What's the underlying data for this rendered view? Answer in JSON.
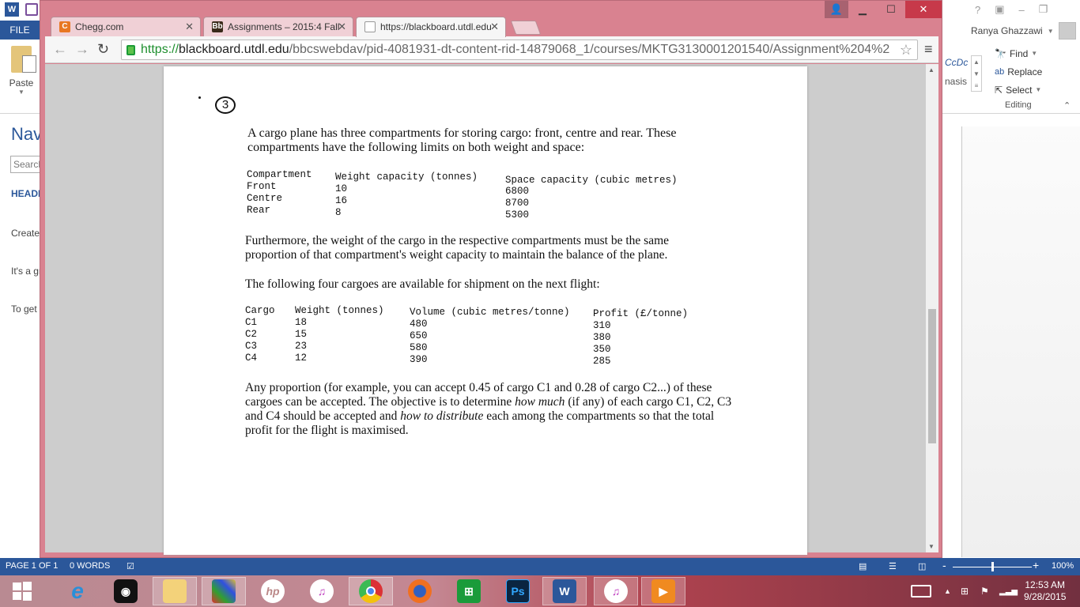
{
  "word": {
    "file_tab": "FILE",
    "paste_label": "Paste",
    "user_name": "Ranya Ghazzawi",
    "styles_preview": "AaBbCcDc",
    "styles_visible_fragment": "CcDc",
    "style_name_fragment": "nasis",
    "editing": {
      "find": "Find",
      "replace": "Replace",
      "select": "Select",
      "group_label": "Editing"
    },
    "navigation": {
      "title": "Navigation",
      "search_placeholder": "Search document",
      "tab_headings": "HEADINGS",
      "paragraphs": [
        "Create an interactive outline of your document.",
        "It's a great way to keep track of where you are or quickly move your content around.",
        "To get started, go to the Home tab and apply Heading styles to the headings in your document."
      ]
    },
    "status": {
      "page": "PAGE 1 OF 1",
      "words": "0 WORDS",
      "zoom": "100%",
      "zoom_level_percent": 100
    }
  },
  "chrome": {
    "tabs": [
      {
        "title": "Chegg.com",
        "favicon": "C",
        "favicon_color": "#e87722",
        "active": false
      },
      {
        "title": "Assignments – 2015:4 Fall",
        "favicon": "Bb",
        "favicon_color": "#3a2a1a",
        "active": false
      },
      {
        "title": "https://blackboard.utdl.edu",
        "favicon": "page",
        "favicon_color": "#ffffff",
        "active": true
      }
    ],
    "url": {
      "scheme": "https://",
      "host": "blackboard.utdl.edu",
      "path": "/bbcswebdav/pid-4081931-dt-content-rid-14879068_1/courses/MKTG3130001201540/Assignment%204%2"
    },
    "frame_color": "#d98290"
  },
  "document": {
    "question_number": "3",
    "intro": "A cargo plane has three compartments for storing cargo: front, centre and rear. These compartments have the following limits on both weight and space:",
    "compartments": {
      "headers": [
        "Compartment",
        "Weight capacity (tonnes)",
        "Space capacity (cubic metres)"
      ],
      "rows": [
        [
          "Front",
          "10",
          "6800"
        ],
        [
          "Centre",
          "16",
          "8700"
        ],
        [
          "Rear",
          "8",
          "5300"
        ]
      ]
    },
    "balance_text": "Furthermore, the weight of the cargo in the respective compartments must be the same proportion of that compartment's weight capacity to maintain the balance of the plane.",
    "cargo_intro": "The following four cargoes are available for shipment on the next flight:",
    "cargoes": {
      "headers": [
        "Cargo",
        "Weight (tonnes)",
        "Volume (cubic metres/tonne)",
        "Profit (£/tonne)"
      ],
      "rows": [
        [
          "C1",
          "18",
          "480",
          "310"
        ],
        [
          "C2",
          "15",
          "650",
          "380"
        ],
        [
          "C3",
          "23",
          "580",
          "350"
        ],
        [
          "C4",
          "12",
          "390",
          "285"
        ]
      ]
    },
    "objective_parts": {
      "p1": "Any proportion (for example, you can accept 0.45 of cargo C1 and 0.28 of cargo C2...) of these cargoes can be accepted. The objective is to determine ",
      "em1": "how much",
      "p2": " (if any) of each cargo C1, C2, C3 and C4 should be accepted and ",
      "em2": "how to distribute",
      "p3": " each among the compartments so that the total profit for the flight is maximised."
    }
  },
  "taskbar": {
    "apps": [
      "start",
      "internet-explorer",
      "webcam",
      "file-explorer",
      "puzzle-app",
      "hp",
      "itunes",
      "chrome",
      "firefox",
      "store",
      "photoshop",
      "word",
      "itunes",
      "media-player"
    ],
    "clock_time": "12:53 AM",
    "clock_date": "9/28/2015"
  }
}
